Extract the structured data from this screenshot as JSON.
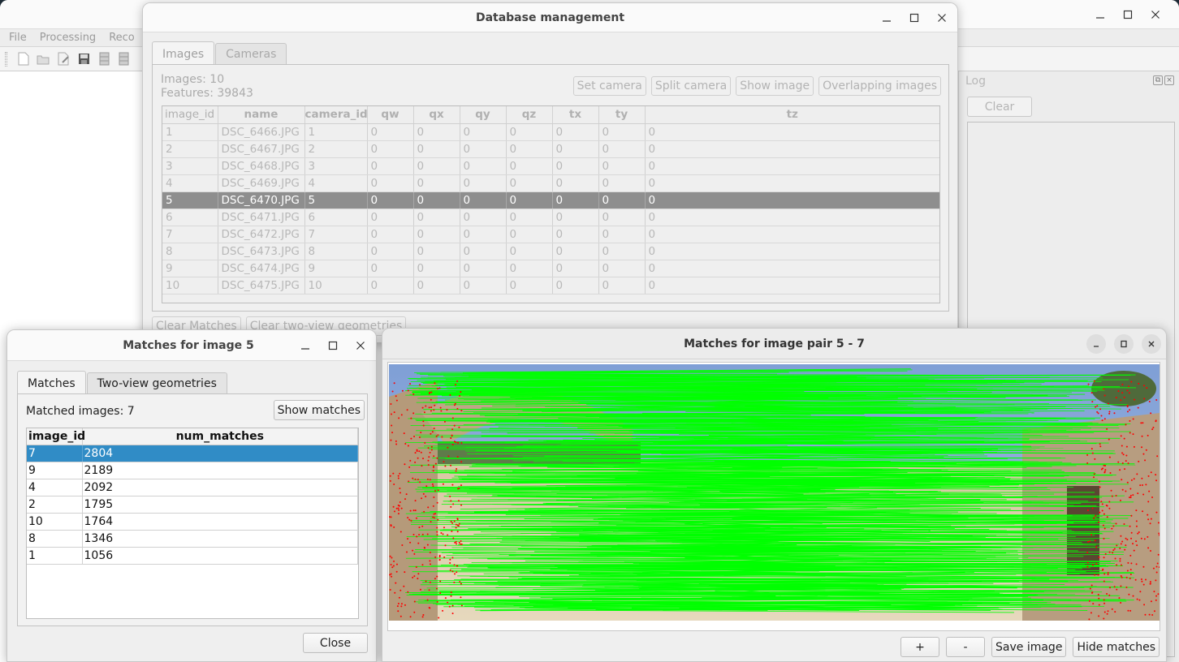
{
  "main_window": {
    "menu": [
      "File",
      "Processing",
      "Reco"
    ],
    "toolbar_icons": [
      "new-project-icon",
      "open-project-icon",
      "edit-project-icon",
      "save-project-icon",
      "import-icon",
      "export-icon"
    ],
    "log": {
      "title": "Log",
      "clear_label": "Clear"
    }
  },
  "db_window": {
    "title": "Database management",
    "tabs": [
      "Images",
      "Cameras"
    ],
    "active_tab": "Images",
    "stats": {
      "images": "Images: 10",
      "features": "Features: 39843"
    },
    "actions": [
      "Set camera",
      "Split camera",
      "Show image",
      "Overlapping images"
    ],
    "table": {
      "columns": [
        "image_id",
        "name",
        "camera_id",
        "qw",
        "qx",
        "qy",
        "qz",
        "tx",
        "ty",
        "tz"
      ],
      "rows": [
        [
          "1",
          "DSC_6466.JPG",
          "1",
          "0",
          "0",
          "0",
          "0",
          "0",
          "0",
          "0"
        ],
        [
          "2",
          "DSC_6467.JPG",
          "2",
          "0",
          "0",
          "0",
          "0",
          "0",
          "0",
          "0"
        ],
        [
          "3",
          "DSC_6468.JPG",
          "3",
          "0",
          "0",
          "0",
          "0",
          "0",
          "0",
          "0"
        ],
        [
          "4",
          "DSC_6469.JPG",
          "4",
          "0",
          "0",
          "0",
          "0",
          "0",
          "0",
          "0"
        ],
        [
          "5",
          "DSC_6470.JPG",
          "5",
          "0",
          "0",
          "0",
          "0",
          "0",
          "0",
          "0"
        ],
        [
          "6",
          "DSC_6471.JPG",
          "6",
          "0",
          "0",
          "0",
          "0",
          "0",
          "0",
          "0"
        ],
        [
          "7",
          "DSC_6472.JPG",
          "7",
          "0",
          "0",
          "0",
          "0",
          "0",
          "0",
          "0"
        ],
        [
          "8",
          "DSC_6473.JPG",
          "8",
          "0",
          "0",
          "0",
          "0",
          "0",
          "0",
          "0"
        ],
        [
          "9",
          "DSC_6474.JPG",
          "9",
          "0",
          "0",
          "0",
          "0",
          "0",
          "0",
          "0"
        ],
        [
          "10",
          "DSC_6475.JPG",
          "10",
          "0",
          "0",
          "0",
          "0",
          "0",
          "0",
          "0"
        ]
      ],
      "selected_row": 4
    },
    "bottom_buttons": [
      "Clear Matches",
      "Clear two-view geometries"
    ]
  },
  "matches_window": {
    "title": "Matches for image 5",
    "tabs": [
      "Matches",
      "Two-view geometries"
    ],
    "active_tab": "Matches",
    "matched_images": "Matched images: 7",
    "show_matches_label": "Show matches",
    "table": {
      "columns": [
        "image_id",
        "num_matches"
      ],
      "rows": [
        [
          "7",
          "2804"
        ],
        [
          "9",
          "2189"
        ],
        [
          "4",
          "2092"
        ],
        [
          "2",
          "1795"
        ],
        [
          "10",
          "1764"
        ],
        [
          "8",
          "1346"
        ],
        [
          "1",
          "1056"
        ]
      ],
      "selected_row": 0
    },
    "close_label": "Close"
  },
  "pair_window": {
    "title": "Matches for image pair 5 - 7",
    "image_description": "Side-by-side photos of stone arch ruins with green feature match lines and red keypoints",
    "match_color": "#00ff00",
    "keypoint_color": "#ff0000",
    "buttons": {
      "zoom_in": "+",
      "zoom_out": "-",
      "save_image": "Save image",
      "hide_matches": "Hide matches"
    }
  },
  "colors": {
    "selection_blue": "#308cc6",
    "selection_gray": "#8e8e8e"
  }
}
